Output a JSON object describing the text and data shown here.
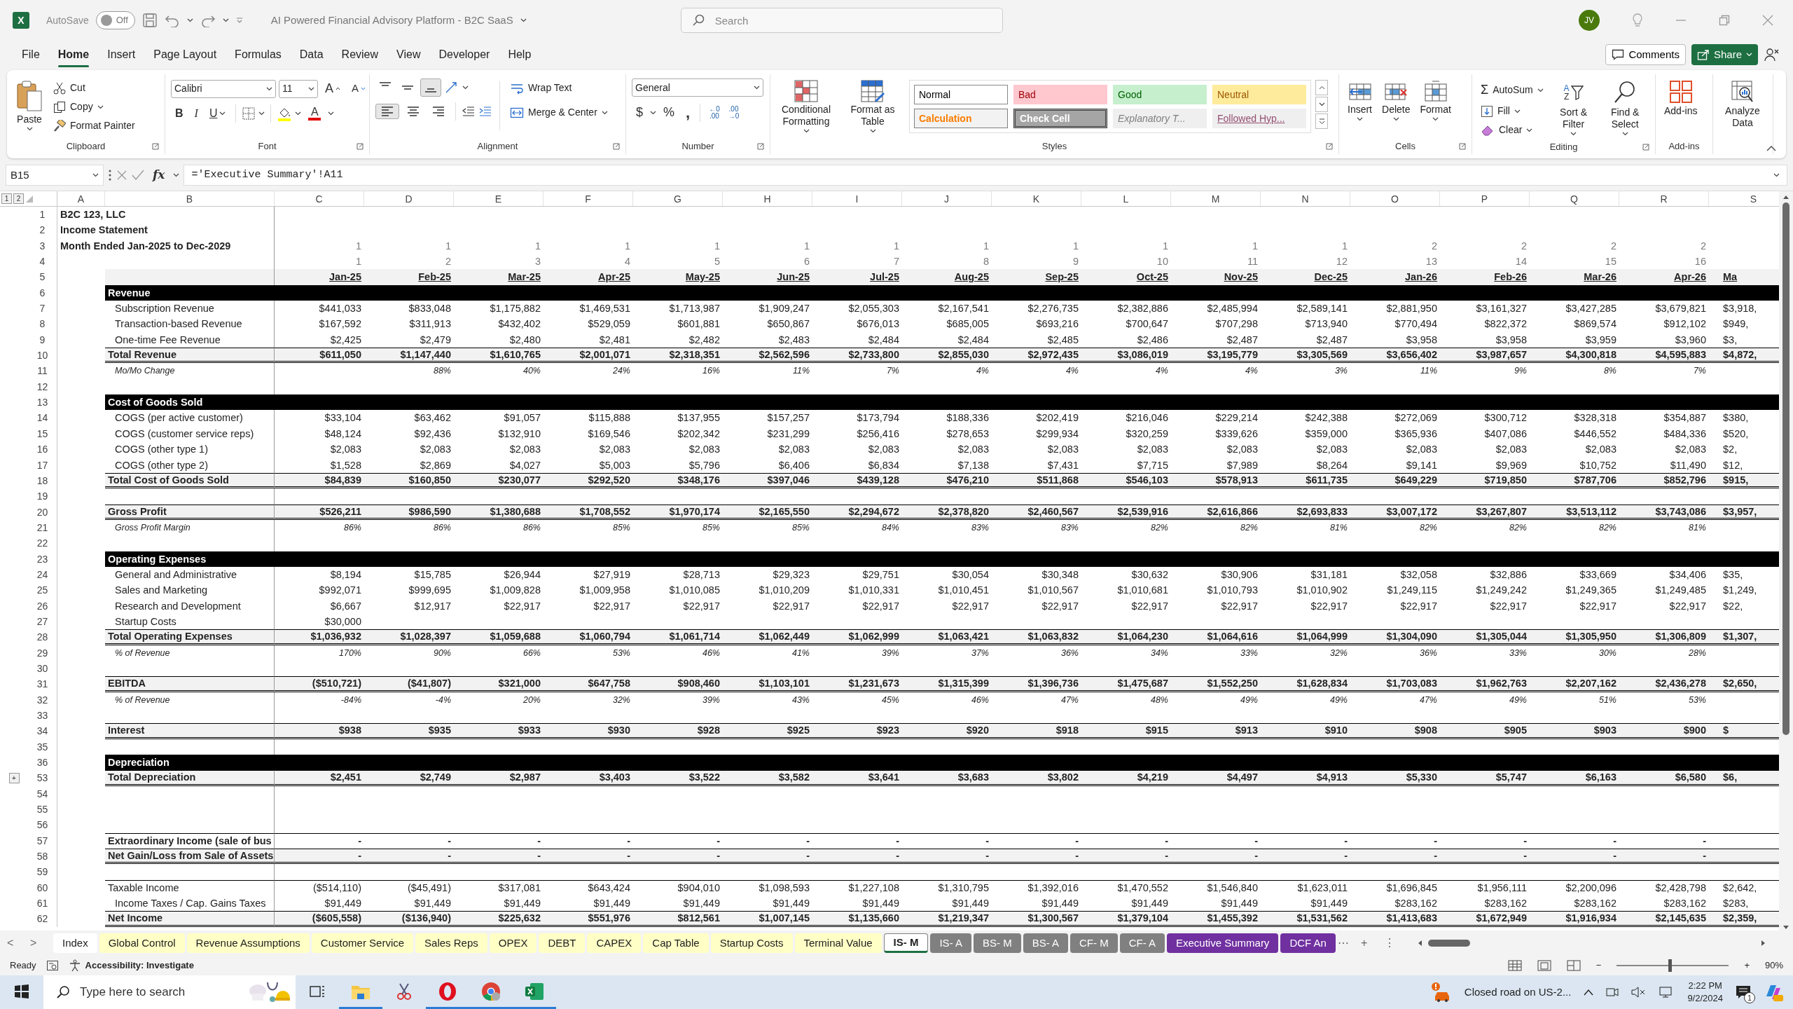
{
  "title_bar": {
    "app_logo": "X",
    "autosave_label": "AutoSave",
    "autosave": {
      "on": false,
      "label": "Off"
    },
    "document_title": "AI Powered Financial Advisory Platform - B2C SaaS",
    "search_placeholder": "Search",
    "avatar": "JV"
  },
  "menu_tabs": [
    {
      "label": "File",
      "selected": false
    },
    {
      "label": "Home",
      "selected": true
    },
    {
      "label": "Insert",
      "selected": false
    },
    {
      "label": "Page Layout",
      "selected": false
    },
    {
      "label": "Formulas",
      "selected": false
    },
    {
      "label": "Data",
      "selected": false
    },
    {
      "label": "Review",
      "selected": false
    },
    {
      "label": "View",
      "selected": false
    },
    {
      "label": "Developer",
      "selected": false
    },
    {
      "label": "Help",
      "selected": false
    }
  ],
  "comments": "Comments",
  "share": "Share",
  "ribbon": {
    "clipboard": {
      "label": "Clipboard",
      "paste": "Paste",
      "cut": "Cut",
      "copy": "Copy",
      "format_painter": "Format Painter"
    },
    "font": {
      "label": "Font",
      "name": "Calibri",
      "size": "11",
      "grow": "A",
      "shrink": "A",
      "bold": "B",
      "italic": "I",
      "underline": "U",
      "font_color": "A"
    },
    "alignment": {
      "label": "Alignment",
      "vertical_align": [
        {
          "on": false
        },
        {
          "on": false
        },
        {
          "on": true
        }
      ],
      "horizontal_align": [
        {
          "on": true
        },
        {
          "on": false
        },
        {
          "on": false
        }
      ],
      "wrap_text": "Wrap Text",
      "merge": "Merge & Center"
    },
    "number": {
      "label": "Number",
      "format": "General",
      "currency": "$",
      "percent": "%",
      "comma": ",",
      "increase_decimal": [
        "←0",
        ".00"
      ],
      "decrease_decimal": [
        ".00",
        "→0"
      ]
    },
    "styles": {
      "label": "Styles",
      "conditional_formatting": "Conditional Formatting",
      "format_as_table": "Format as Table",
      "cell_styles": [
        {
          "label": "Normal",
          "kind": "normal"
        },
        {
          "label": "Bad",
          "kind": "bad"
        },
        {
          "label": "Good",
          "kind": "good"
        },
        {
          "label": "Neutral",
          "kind": "neutral"
        },
        {
          "label": "Calculation",
          "kind": "calculation"
        },
        {
          "label": "Check Cell",
          "kind": "check"
        },
        {
          "label": "Explanatory T...",
          "kind": "explanatory"
        },
        {
          "label": "Followed Hyp...",
          "kind": "hyperlink"
        }
      ]
    },
    "cells": {
      "label": "Cells",
      "buttons": [
        "Insert",
        "Delete",
        "Format"
      ]
    },
    "editing": {
      "label": "Editing",
      "autosum_symbol": "Σ",
      "autosum": "AutoSum",
      "fill": "Fill",
      "clear": "Clear",
      "sort_letters": [
        "A",
        "Z"
      ],
      "sort_filter": "Sort & Filter",
      "find_select": "Find & Select"
    },
    "addins": {
      "label": "Add-ins",
      "button": "Add-ins"
    },
    "analyze": {
      "button": "Analyze Data"
    }
  },
  "formula_bar": {
    "name_box": "B15",
    "fx": "fx",
    "formula": "='Executive Summary'!A11"
  },
  "sheet": {
    "outline_levels": [
      "1",
      "2"
    ],
    "columns": [
      "A",
      "B",
      "C",
      "D",
      "E",
      "F",
      "G",
      "H",
      "I",
      "J",
      "K",
      "L",
      "M",
      "N",
      "O",
      "P",
      "Q",
      "R",
      "S"
    ],
    "rows": [
      {
        "num": "1",
        "kind": "title",
        "label": "B2C 123, LLC"
      },
      {
        "num": "2",
        "kind": "title",
        "label": "Income Statement"
      },
      {
        "num": "3",
        "kind": "title",
        "label": "Month Ended Jan-2025 to Dec-2029",
        "cells": [
          "1",
          "1",
          "1",
          "1",
          "1",
          "1",
          "1",
          "1",
          "1",
          "1",
          "1",
          "1",
          "2",
          "2",
          "2",
          "2"
        ]
      },
      {
        "num": "4",
        "kind": "index",
        "cells": [
          "1",
          "2",
          "3",
          "4",
          "5",
          "6",
          "7",
          "8",
          "9",
          "10",
          "11",
          "12",
          "13",
          "14",
          "15",
          "16"
        ]
      },
      {
        "num": "5",
        "kind": "dates",
        "cells": [
          "Jan-25",
          "Feb-25",
          "Mar-25",
          "Apr-25",
          "May-25",
          "Jun-25",
          "Jul-25",
          "Aug-25",
          "Sep-25",
          "Oct-25",
          "Nov-25",
          "Dec-25",
          "Jan-26",
          "Feb-26",
          "Mar-26",
          "Apr-26",
          "Ma"
        ]
      },
      {
        "num": "6",
        "kind": "section",
        "label": "Revenue"
      },
      {
        "num": "7",
        "kind": "item",
        "label": "Subscription Revenue",
        "cells": [
          "$441,033",
          "$833,048",
          "$1,175,882",
          "$1,469,531",
          "$1,713,987",
          "$1,909,247",
          "$2,055,303",
          "$2,167,541",
          "$2,276,735",
          "$2,382,886",
          "$2,485,994",
          "$2,589,141",
          "$2,881,950",
          "$3,161,327",
          "$3,427,285",
          "$3,679,821",
          "$3,918,"
        ]
      },
      {
        "num": "8",
        "kind": "item",
        "label": "Transaction-based Revenue",
        "cells": [
          "$167,592",
          "$311,913",
          "$432,402",
          "$529,059",
          "$601,881",
          "$650,867",
          "$676,013",
          "$685,005",
          "$693,216",
          "$700,647",
          "$707,298",
          "$713,940",
          "$770,494",
          "$822,372",
          "$869,574",
          "$912,102",
          "$949,"
        ]
      },
      {
        "num": "9",
        "kind": "item",
        "label": "One-time Fee Revenue",
        "cells": [
          "$2,425",
          "$2,479",
          "$2,480",
          "$2,481",
          "$2,482",
          "$2,483",
          "$2,484",
          "$2,484",
          "$2,485",
          "$2,486",
          "$2,487",
          "$2,487",
          "$3,958",
          "$3,958",
          "$3,959",
          "$3,960",
          "$3,"
        ]
      },
      {
        "num": "10",
        "kind": "total",
        "label": "Total Revenue",
        "cells": [
          "$611,050",
          "$1,147,440",
          "$1,610,765",
          "$2,001,071",
          "$2,318,351",
          "$2,562,596",
          "$2,733,800",
          "$2,855,030",
          "$2,972,435",
          "$3,086,019",
          "$3,195,779",
          "$3,305,569",
          "$3,656,402",
          "$3,987,657",
          "$4,300,818",
          "$4,595,883",
          "$4,872,"
        ]
      },
      {
        "num": "11",
        "kind": "pct",
        "label": "Mo/Mo Change",
        "cells": [
          null,
          "88%",
          "40%",
          "24%",
          "16%",
          "11%",
          "7%",
          "4%",
          "4%",
          "4%",
          "4%",
          "3%",
          "11%",
          "9%",
          "8%",
          "7%"
        ]
      },
      {
        "num": "12",
        "kind": "blank"
      },
      {
        "num": "13",
        "kind": "section",
        "label": "Cost of Goods Sold"
      },
      {
        "num": "14",
        "kind": "item",
        "label": "COGS (per active customer)",
        "cells": [
          "$33,104",
          "$63,462",
          "$91,057",
          "$115,888",
          "$137,955",
          "$157,257",
          "$173,794",
          "$188,336",
          "$202,419",
          "$216,046",
          "$229,214",
          "$242,388",
          "$272,069",
          "$300,712",
          "$328,318",
          "$354,887",
          "$380,"
        ]
      },
      {
        "num": "15",
        "kind": "item",
        "label": "COGS (customer service reps)",
        "cells": [
          "$48,124",
          "$92,436",
          "$132,910",
          "$169,546",
          "$202,342",
          "$231,299",
          "$256,416",
          "$278,653",
          "$299,934",
          "$320,259",
          "$339,626",
          "$359,000",
          "$365,936",
          "$407,086",
          "$446,552",
          "$484,336",
          "$520,"
        ]
      },
      {
        "num": "16",
        "kind": "item",
        "label": "COGS (other type 1)",
        "cells": [
          "$2,083",
          "$2,083",
          "$2,083",
          "$2,083",
          "$2,083",
          "$2,083",
          "$2,083",
          "$2,083",
          "$2,083",
          "$2,083",
          "$2,083",
          "$2,083",
          "$2,083",
          "$2,083",
          "$2,083",
          "$2,083",
          "$2,"
        ]
      },
      {
        "num": "17",
        "kind": "item",
        "label": "COGS (other type 2)",
        "cells": [
          "$1,528",
          "$2,869",
          "$4,027",
          "$5,003",
          "$5,796",
          "$6,406",
          "$6,834",
          "$7,138",
          "$7,431",
          "$7,715",
          "$7,989",
          "$8,264",
          "$9,141",
          "$9,969",
          "$10,752",
          "$11,490",
          "$12,"
        ]
      },
      {
        "num": "18",
        "kind": "total",
        "label": "Total Cost of Goods Sold",
        "cells": [
          "$84,839",
          "$160,850",
          "$230,077",
          "$292,520",
          "$348,176",
          "$397,046",
          "$439,128",
          "$476,210",
          "$511,868",
          "$546,103",
          "$578,913",
          "$611,735",
          "$649,229",
          "$719,850",
          "$787,706",
          "$852,796",
          "$915,"
        ]
      },
      {
        "num": "19",
        "kind": "blank"
      },
      {
        "num": "20",
        "kind": "total",
        "label": "Gross Profit",
        "cells": [
          "$526,211",
          "$986,590",
          "$1,380,688",
          "$1,708,552",
          "$1,970,174",
          "$2,165,550",
          "$2,294,672",
          "$2,378,820",
          "$2,460,567",
          "$2,539,916",
          "$2,616,866",
          "$2,693,833",
          "$3,007,172",
          "$3,267,807",
          "$3,513,112",
          "$3,743,086",
          "$3,957,"
        ]
      },
      {
        "num": "21",
        "kind": "pct",
        "label": "Gross Profit Margin",
        "cells": [
          "86%",
          "86%",
          "86%",
          "85%",
          "85%",
          "85%",
          "84%",
          "83%",
          "83%",
          "82%",
          "82%",
          "81%",
          "82%",
          "82%",
          "82%",
          "81%"
        ]
      },
      {
        "num": "22",
        "kind": "blank"
      },
      {
        "num": "23",
        "kind": "section",
        "label": "Operating Expenses"
      },
      {
        "num": "24",
        "kind": "item",
        "label": "General and Administrative",
        "cells": [
          "$8,194",
          "$15,785",
          "$26,944",
          "$27,919",
          "$28,713",
          "$29,323",
          "$29,751",
          "$30,054",
          "$30,348",
          "$30,632",
          "$30,906",
          "$31,181",
          "$32,058",
          "$32,886",
          "$33,669",
          "$34,406",
          "$35,"
        ]
      },
      {
        "num": "25",
        "kind": "item",
        "label": "Sales and Marketing",
        "cells": [
          "$992,071",
          "$999,695",
          "$1,009,828",
          "$1,009,958",
          "$1,010,085",
          "$1,010,209",
          "$1,010,331",
          "$1,010,451",
          "$1,010,567",
          "$1,010,681",
          "$1,010,793",
          "$1,010,902",
          "$1,249,115",
          "$1,249,242",
          "$1,249,365",
          "$1,249,485",
          "$1,249,"
        ]
      },
      {
        "num": "26",
        "kind": "item",
        "label": "Research and Development",
        "cells": [
          "$6,667",
          "$12,917",
          "$22,917",
          "$22,917",
          "$22,917",
          "$22,917",
          "$22,917",
          "$22,917",
          "$22,917",
          "$22,917",
          "$22,917",
          "$22,917",
          "$22,917",
          "$22,917",
          "$22,917",
          "$22,917",
          "$22,"
        ]
      },
      {
        "num": "27",
        "kind": "item",
        "label": "Startup Costs",
        "cells": [
          "$30,000"
        ]
      },
      {
        "num": "28",
        "kind": "total",
        "label": "Total Operating Expenses",
        "cells": [
          "$1,036,932",
          "$1,028,397",
          "$1,059,688",
          "$1,060,794",
          "$1,061,714",
          "$1,062,449",
          "$1,062,999",
          "$1,063,421",
          "$1,063,832",
          "$1,064,230",
          "$1,064,616",
          "$1,064,999",
          "$1,304,090",
          "$1,305,044",
          "$1,305,950",
          "$1,306,809",
          "$1,307,"
        ]
      },
      {
        "num": "29",
        "kind": "pct",
        "label": "% of Revenue",
        "cells": [
          "170%",
          "90%",
          "66%",
          "53%",
          "46%",
          "41%",
          "39%",
          "37%",
          "36%",
          "34%",
          "33%",
          "32%",
          "36%",
          "33%",
          "30%",
          "28%"
        ]
      },
      {
        "num": "30",
        "kind": "blank"
      },
      {
        "num": "31",
        "kind": "total",
        "label": "EBITDA",
        "cells": [
          "($510,721)",
          "($41,807)",
          "$321,000",
          "$647,758",
          "$908,460",
          "$1,103,101",
          "$1,231,673",
          "$1,315,399",
          "$1,396,736",
          "$1,475,687",
          "$1,552,250",
          "$1,628,834",
          "$1,703,083",
          "$1,962,763",
          "$2,207,162",
          "$2,436,278",
          "$2,650,"
        ]
      },
      {
        "num": "32",
        "kind": "pct",
        "label": "% of Revenue",
        "cells": [
          "-84%",
          "-4%",
          "20%",
          "32%",
          "39%",
          "43%",
          "45%",
          "46%",
          "47%",
          "48%",
          "49%",
          "49%",
          "47%",
          "49%",
          "51%",
          "53%"
        ]
      },
      {
        "num": "33",
        "kind": "blank"
      },
      {
        "num": "34",
        "kind": "total",
        "label": "Interest",
        "cells": [
          "$938",
          "$935",
          "$933",
          "$930",
          "$928",
          "$925",
          "$923",
          "$920",
          "$918",
          "$915",
          "$913",
          "$910",
          "$908",
          "$905",
          "$903",
          "$900",
          "$"
        ]
      },
      {
        "num": "35",
        "kind": "blank"
      },
      {
        "num": "36",
        "kind": "section",
        "label": "Depreciation"
      },
      {
        "num": "53",
        "kind": "total",
        "label": "Total Depreciation",
        "outline_button": "+",
        "cells": [
          "$2,451",
          "$2,749",
          "$2,987",
          "$3,403",
          "$3,522",
          "$3,582",
          "$3,641",
          "$3,683",
          "$3,802",
          "$4,219",
          "$4,497",
          "$4,913",
          "$5,330",
          "$5,747",
          "$6,163",
          "$6,580",
          "$6,"
        ]
      },
      {
        "num": "54",
        "kind": "blank"
      },
      {
        "num": "55",
        "kind": "blank"
      },
      {
        "num": "56",
        "kind": "blank"
      },
      {
        "num": "57",
        "kind": "subtotal",
        "label": "Extraordinary Income (sale of bus",
        "cells": [
          "-",
          "-",
          "-",
          "-",
          "-",
          "-",
          "-",
          "-",
          "-",
          "-",
          "-",
          "-",
          "-",
          "-",
          "-",
          "-"
        ]
      },
      {
        "num": "58",
        "kind": "total",
        "label": "Net Gain/Loss from Sale of Assets",
        "cells": [
          "-",
          "-",
          "-",
          "-",
          "-",
          "-",
          "-",
          "-",
          "-",
          "-",
          "-",
          "-",
          "-",
          "-",
          "-",
          "-"
        ]
      },
      {
        "num": "59",
        "kind": "blank"
      },
      {
        "num": "60",
        "kind": "plain",
        "label": "Taxable Income",
        "cells": [
          "($514,110)",
          "($45,491)",
          "$317,081",
          "$643,424",
          "$904,010",
          "$1,098,593",
          "$1,227,108",
          "$1,310,795",
          "$1,392,016",
          "$1,470,552",
          "$1,546,840",
          "$1,623,011",
          "$1,696,845",
          "$1,956,111",
          "$2,200,096",
          "$2,428,798",
          "$2,642,"
        ]
      },
      {
        "num": "61",
        "kind": "item",
        "label": "Income Taxes / Cap. Gains Taxes",
        "cells": [
          "$91,449",
          "$91,449",
          "$91,449",
          "$91,449",
          "$91,449",
          "$91,449",
          "$91,449",
          "$91,449",
          "$91,449",
          "$91,449",
          "$91,449",
          "$91,449",
          "$283,162",
          "$283,162",
          "$283,162",
          "$283,162",
          "$283,"
        ]
      },
      {
        "num": "62",
        "kind": "total",
        "label": "Net Income",
        "cells": [
          "($605,558)",
          "($136,940)",
          "$225,632",
          "$551,976",
          "$812,561",
          "$1,007,145",
          "$1,135,660",
          "$1,219,347",
          "$1,300,567",
          "$1,379,104",
          "$1,455,392",
          "$1,531,562",
          "$1,413,683",
          "$1,672,949",
          "$1,916,934",
          "$2,145,635",
          "$2,359,"
        ]
      }
    ]
  },
  "sheet_nav": {
    "prev": "<",
    "next": ">",
    "more": "⋯",
    "add": "+",
    "options": "⋮"
  },
  "sheet_tabs": [
    {
      "label": "Index",
      "selected": false,
      "color": "#ffffff"
    },
    {
      "label": "Global Control",
      "selected": false,
      "color": "#ffffc6"
    },
    {
      "label": "Revenue Assumptions",
      "selected": false,
      "color": "#ffffc6"
    },
    {
      "label": "Customer Service",
      "selected": false,
      "color": "#ffffc6"
    },
    {
      "label": "Sales Reps",
      "selected": false,
      "color": "#ffffc6"
    },
    {
      "label": "OPEX",
      "selected": false,
      "color": "#ffffc6"
    },
    {
      "label": "DEBT",
      "selected": false,
      "color": "#ffffc6"
    },
    {
      "label": "CAPEX",
      "selected": false,
      "color": "#ffffc6"
    },
    {
      "label": "Cap Table",
      "selected": false,
      "color": "#ffffc6"
    },
    {
      "label": "Startup Costs",
      "selected": false,
      "color": "#ffffc6"
    },
    {
      "label": "Terminal Value",
      "selected": false,
      "color": "#ffffc6"
    },
    {
      "label": "IS- M",
      "selected": true,
      "color": "#808080"
    },
    {
      "label": "IS- A",
      "selected": false,
      "color": "#808080"
    },
    {
      "label": "BS- M",
      "selected": false,
      "color": "#808080"
    },
    {
      "label": "BS- A",
      "selected": false,
      "color": "#808080"
    },
    {
      "label": "CF- M",
      "selected": false,
      "color": "#808080"
    },
    {
      "label": "CF- A",
      "selected": false,
      "color": "#808080"
    },
    {
      "label": "Executive Summary",
      "selected": false,
      "color": "#7030a0"
    },
    {
      "label": "DCF An",
      "selected": false,
      "color": "#7030a0"
    }
  ],
  "status_bar": {
    "ready": "Ready",
    "accessibility": "Accessibility: Investigate",
    "zoom": {
      "minus": "−",
      "plus": "+",
      "level": 0.47,
      "reading": "90%"
    }
  },
  "taskbar": {
    "search_placeholder": "Type here to search",
    "news": "Closed road on US-2...",
    "time": "2:22 PM",
    "date": "9/2/2024",
    "notifications": "1"
  }
}
